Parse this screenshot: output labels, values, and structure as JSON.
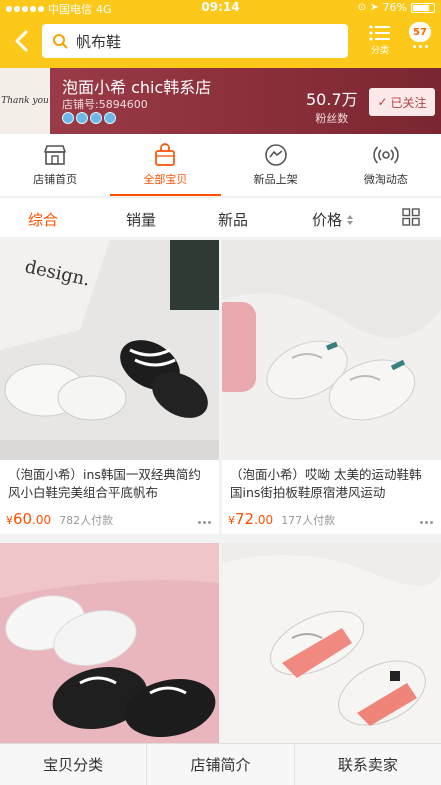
{
  "status": {
    "carrier": "中国电信",
    "network": "4G",
    "time": "09:14",
    "battery": "76%"
  },
  "header": {
    "search_text": "帆布鞋",
    "category_label": "分类",
    "more_badge": "57"
  },
  "shop": {
    "logo_text": "Thank you",
    "name": "泡面小希 chic韩系店",
    "id_text": "店铺号:5894600",
    "fans_count": "50.7万",
    "fans_label": "粉丝数",
    "follow_label": "已关注"
  },
  "nav_tabs": [
    {
      "label": "店铺首页",
      "icon": "store-icon"
    },
    {
      "label": "全部宝贝",
      "icon": "bag-icon",
      "active": true
    },
    {
      "label": "新品上架",
      "icon": "bolt-chat-icon"
    },
    {
      "label": "微淘动态",
      "icon": "broadcast-icon"
    }
  ],
  "sort_bar": {
    "items": [
      "综合",
      "销量",
      "新品",
      "价格"
    ],
    "active": "综合"
  },
  "products": [
    {
      "title": "（泡面小希）ins韩国一双经典简约风小白鞋完美组合平底帆布",
      "currency": "¥",
      "price_int": "60",
      "price_dec": ".00",
      "sold": "782人付款"
    },
    {
      "title": "（泡面小希）哎呦 太美的运动鞋韩国ins街拍板鞋原宿港风运动",
      "currency": "¥",
      "price_int": "72",
      "price_dec": ".00",
      "sold": "177人付款"
    },
    {
      "title": "",
      "currency": "",
      "price_int": "",
      "price_dec": "",
      "sold": ""
    },
    {
      "title": "",
      "currency": "",
      "price_int": "",
      "price_dec": "",
      "sold": ""
    }
  ],
  "bottom_bar": {
    "items": [
      "宝贝分类",
      "店铺简介",
      "联系卖家"
    ]
  },
  "colors": {
    "brand_yellow": "#fcc81a",
    "accent_orange": "#ff5000",
    "shop_banner": "#8a2f3a"
  }
}
